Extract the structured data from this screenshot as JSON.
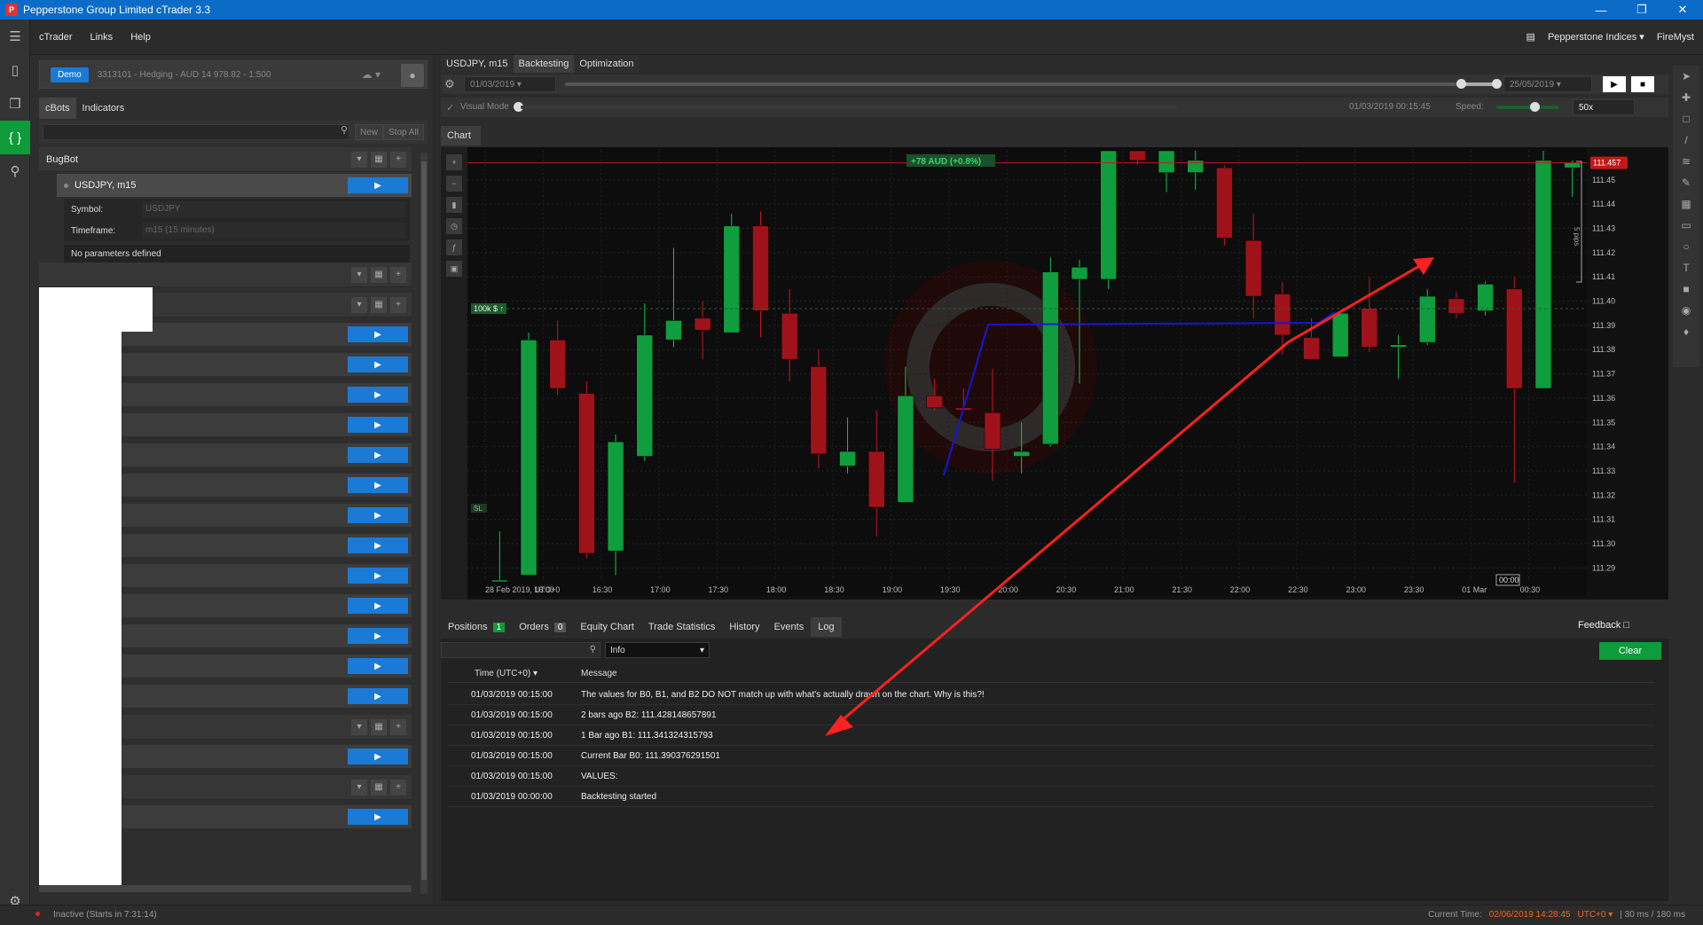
{
  "window": {
    "title": "Pepperstone Group Limited cTrader 3.3",
    "icon_letter": "P"
  },
  "menu": {
    "items": [
      "cTrader",
      "Links",
      "Help"
    ],
    "broker": "Pepperstone Indices",
    "user": "FireMyst"
  },
  "account": {
    "badge": "Demo",
    "text": "3313101 - Hedging - AUD 14 978.82 - 1:500"
  },
  "left_tabs": [
    "cBots",
    "Indicators"
  ],
  "left_buttons": {
    "new": "New",
    "stop_all": "Stop All"
  },
  "bot": {
    "name": "BugBot",
    "instance": "USDJPY, m15",
    "params": [
      {
        "label": "Symbol:",
        "value": "USDJPY"
      },
      {
        "label": "Timeframe:",
        "value": "m15 (15 minutes)"
      }
    ],
    "no_params": "No parameters defined"
  },
  "chart_tabs": [
    "USDJPY, m15",
    "Backtesting",
    "Optimization"
  ],
  "backtest": {
    "start_date": "01/03/2019",
    "end_date": "25/05/2019",
    "visual_mode": "Visual Mode",
    "timestamp": "01/03/2019 00:15:45",
    "speed_label": "Speed:",
    "speed": "50x"
  },
  "chart": {
    "tab": "Chart",
    "pl_label": "+78 AUD (+0.8%)",
    "volume_label": "100k $",
    "price_label": "111.457",
    "pips_label": "5 pips",
    "sl_label": "SL",
    "cursor_time": "00:00",
    "colors": {
      "bull": "#0f9d3e",
      "bear": "#a0121a",
      "line": "#1515d8",
      "arrow": "#ff2020"
    }
  },
  "chart_data": {
    "type": "candlestick",
    "symbol": "USDJPY",
    "timeframe": "m15",
    "y_ticks": [
      111.45,
      111.44,
      111.43,
      111.42,
      111.41,
      111.4,
      111.39,
      111.38,
      111.37,
      111.36,
      111.35,
      111.34,
      111.33,
      111.32,
      111.31,
      111.3,
      111.29
    ],
    "x_ticks": [
      "28 Feb 2019, UTC+0",
      "16:00",
      "16:30",
      "17:00",
      "17:30",
      "18:00",
      "18:30",
      "19:00",
      "19:30",
      "20:00",
      "20:30",
      "21:00",
      "21:30",
      "22:00",
      "22:30",
      "23:00",
      "23:30",
      "01 Mar",
      "00:30"
    ],
    "ylim": [
      111.285,
      111.462
    ],
    "candles": [
      {
        "o": 111.285,
        "h": 111.305,
        "l": 111.285,
        "c": 111.285
      },
      {
        "o": 111.287,
        "h": 111.387,
        "l": 111.287,
        "c": 111.384
      },
      {
        "o": 111.384,
        "h": 111.392,
        "l": 111.361,
        "c": 111.364
      },
      {
        "o": 111.362,
        "h": 111.367,
        "l": 111.294,
        "c": 111.296
      },
      {
        "o": 111.297,
        "h": 111.345,
        "l": 111.287,
        "c": 111.342
      },
      {
        "o": 111.336,
        "h": 111.399,
        "l": 111.334,
        "c": 111.386
      },
      {
        "o": 111.384,
        "h": 111.422,
        "l": 111.381,
        "c": 111.392
      },
      {
        "o": 111.393,
        "h": 111.4,
        "l": 111.376,
        "c": 111.388
      },
      {
        "o": 111.387,
        "h": 111.436,
        "l": 111.387,
        "c": 111.431
      },
      {
        "o": 111.431,
        "h": 111.437,
        "l": 111.385,
        "c": 111.396
      },
      {
        "o": 111.395,
        "h": 111.405,
        "l": 111.367,
        "c": 111.376
      },
      {
        "o": 111.373,
        "h": 111.38,
        "l": 111.331,
        "c": 111.337
      },
      {
        "o": 111.332,
        "h": 111.352,
        "l": 111.329,
        "c": 111.338
      },
      {
        "o": 111.338,
        "h": 111.355,
        "l": 111.303,
        "c": 111.315
      },
      {
        "o": 111.317,
        "h": 111.373,
        "l": 111.317,
        "c": 111.361
      },
      {
        "o": 111.361,
        "h": 111.368,
        "l": 111.355,
        "c": 111.356
      },
      {
        "o": 111.356,
        "h": 111.364,
        "l": 111.355,
        "c": 111.355
      },
      {
        "o": 111.354,
        "h": 111.372,
        "l": 111.326,
        "c": 111.339
      },
      {
        "o": 111.336,
        "h": 111.35,
        "l": 111.329,
        "c": 111.338
      },
      {
        "o": 111.341,
        "h": 111.418,
        "l": 111.34,
        "c": 111.412
      },
      {
        "o": 111.409,
        "h": 111.417,
        "l": 111.366,
        "c": 111.414
      },
      {
        "o": 111.409,
        "h": 111.462,
        "l": 111.405,
        "c": 111.462
      },
      {
        "o": 111.462,
        "h": 111.462,
        "l": 111.456,
        "c": 111.458
      },
      {
        "o": 111.453,
        "h": 111.462,
        "l": 111.445,
        "c": 111.462
      },
      {
        "o": 111.453,
        "h": 111.462,
        "l": 111.446,
        "c": 111.458
      },
      {
        "o": 111.455,
        "h": 111.456,
        "l": 111.423,
        "c": 111.426
      },
      {
        "o": 111.425,
        "h": 111.436,
        "l": 111.393,
        "c": 111.402
      },
      {
        "o": 111.403,
        "h": 111.408,
        "l": 111.378,
        "c": 111.386
      },
      {
        "o": 111.385,
        "h": 111.393,
        "l": 111.378,
        "c": 111.376
      },
      {
        "o": 111.377,
        "h": 111.396,
        "l": 111.377,
        "c": 111.395
      },
      {
        "o": 111.397,
        "h": 111.41,
        "l": 111.379,
        "c": 111.381
      },
      {
        "o": 111.381,
        "h": 111.386,
        "l": 111.368,
        "c": 111.382
      },
      {
        "o": 111.383,
        "h": 111.405,
        "l": 111.382,
        "c": 111.402
      },
      {
        "o": 111.401,
        "h": 111.404,
        "l": 111.393,
        "c": 111.395
      },
      {
        "o": 111.396,
        "h": 111.408,
        "l": 111.394,
        "c": 111.407
      },
      {
        "o": 111.405,
        "h": 111.41,
        "l": 111.325,
        "c": 111.364
      },
      {
        "o": 111.364,
        "h": 111.462,
        "l": 111.364,
        "c": 111.458
      },
      {
        "o": 111.455,
        "h": 111.458,
        "l": 111.443,
        "c": 111.457
      }
    ]
  },
  "bottom_tabs": [
    {
      "label": "Positions",
      "badge": "1"
    },
    {
      "label": "Orders",
      "badge": "0"
    },
    {
      "label": "Equity Chart"
    },
    {
      "label": "Trade Statistics"
    },
    {
      "label": "History"
    },
    {
      "label": "Events"
    },
    {
      "label": "Log"
    }
  ],
  "feedback": "Feedback",
  "log": {
    "filter": "Info",
    "clear": "Clear",
    "col_time": "Time (UTC+0)",
    "col_message": "Message",
    "rows": [
      {
        "time": "01/03/2019 00:15:00",
        "message": "The values for B0, B1, and B2 DO NOT match up with what's actually drawn on the chart. Why is this?!"
      },
      {
        "time": "01/03/2019 00:15:00",
        "message": "2 bars ago B2: 111.428148657891"
      },
      {
        "time": "01/03/2019 00:15:00",
        "message": "1 Bar ago B1: 111.341324315793"
      },
      {
        "time": "01/03/2019 00:15:00",
        "message": "Current Bar B0: 111.390376291501"
      },
      {
        "time": "01/03/2019 00:15:00",
        "message": "VALUES:"
      },
      {
        "time": "01/03/2019 00:00:00",
        "message": "Backtesting started"
      }
    ]
  },
  "status": {
    "left": "Inactive (Starts in 7:31:14)",
    "current_time_label": "Current Time:",
    "current_time": "02/06/2019 14:28:45",
    "tz": "UTC+0",
    "latency": "| 30 ms / 180 ms"
  }
}
